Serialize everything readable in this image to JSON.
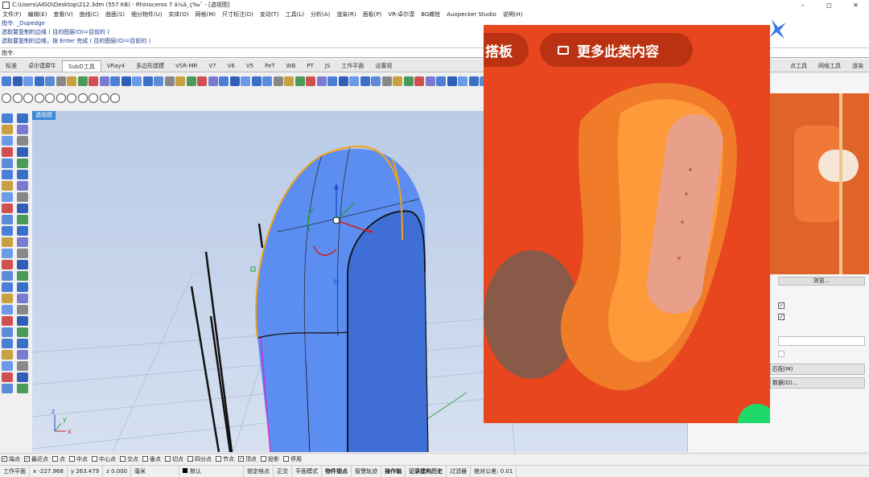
{
  "window": {
    "title": "C:\\Users\\AIGO\\Desktop\\212.3dm (557 KB) - Rhinoceros 7 ä¼ä¸ç‰ˆ - [透视图]",
    "min": "–",
    "max": "◻",
    "close": "✕"
  },
  "menu": [
    "文件(F)",
    "编辑(E)",
    "查看(V)",
    "曲线(C)",
    "曲面(S)",
    "细分物件(U)",
    "实体(O)",
    "网格(M)",
    "尺寸标注(D)",
    "变动(T)",
    "工具(L)",
    "分析(A)",
    "渲染(R)",
    "面板(P)",
    "VR-卓尔漠",
    "BG螺栓",
    "Auxpecker Studio",
    "说明(H)"
  ],
  "command_history": [
    "指令: _Dupedge",
    "选取要复制的边缘 ( 目的图层(O)=目前的 )",
    "选取要复制的边缘，按 Enter 完成 ( 目的图层(O)=目前的 )"
  ],
  "command_prompt": "指令:",
  "tabs": [
    "标准",
    "卓尔谟犀牛",
    "SubD工具",
    "VRay4",
    "多边形建模",
    "VSR-MR",
    "V7",
    "V6",
    "V5",
    "PeT",
    "WB",
    "PT",
    "JS",
    "工作平面",
    "设置视"
  ],
  "right_tabs": [
    "点工具",
    "网格工具",
    "渲染"
  ],
  "viewport": {
    "label": "透视图",
    "axis_x": "x",
    "axis_y": "y",
    "axis_z": "z"
  },
  "overlay": {
    "button1": "搭板",
    "button2": "更多此类内容",
    "image_icon": "image-icon"
  },
  "right_panel": {
    "btn1": "浏览...",
    "btn2": "匹配(M)",
    "btn3": "数据(D)..."
  },
  "osnap": [
    {
      "label": "端点",
      "checked": true
    },
    {
      "label": "最近点",
      "checked": true
    },
    {
      "label": "点",
      "checked": false
    },
    {
      "label": "中点",
      "checked": false
    },
    {
      "label": "中心点",
      "checked": false
    },
    {
      "label": "交点",
      "checked": false
    },
    {
      "label": "垂点",
      "checked": false
    },
    {
      "label": "切点",
      "checked": false
    },
    {
      "label": "四分点",
      "checked": false
    },
    {
      "label": "节点",
      "checked": false
    },
    {
      "label": "顶点",
      "checked": true
    },
    {
      "label": "投影",
      "checked": false
    },
    {
      "label": "停用",
      "checked": false
    }
  ],
  "status": {
    "cplane": "工作平面",
    "x": "x -227.968",
    "y": "y 263.479",
    "z": "z 0.000",
    "units": "毫米",
    "layer": "默认",
    "items": [
      "锁定格点",
      "正交",
      "平面模式",
      "物件锁点",
      "智慧轨迹",
      "操作轴",
      "记录建构历史",
      "过滤器",
      "绝对公差: 0.01"
    ]
  },
  "colors": {
    "accent": "#3a88d6",
    "overlay_bg": "#e8461e",
    "model": "#5b8ef0"
  }
}
